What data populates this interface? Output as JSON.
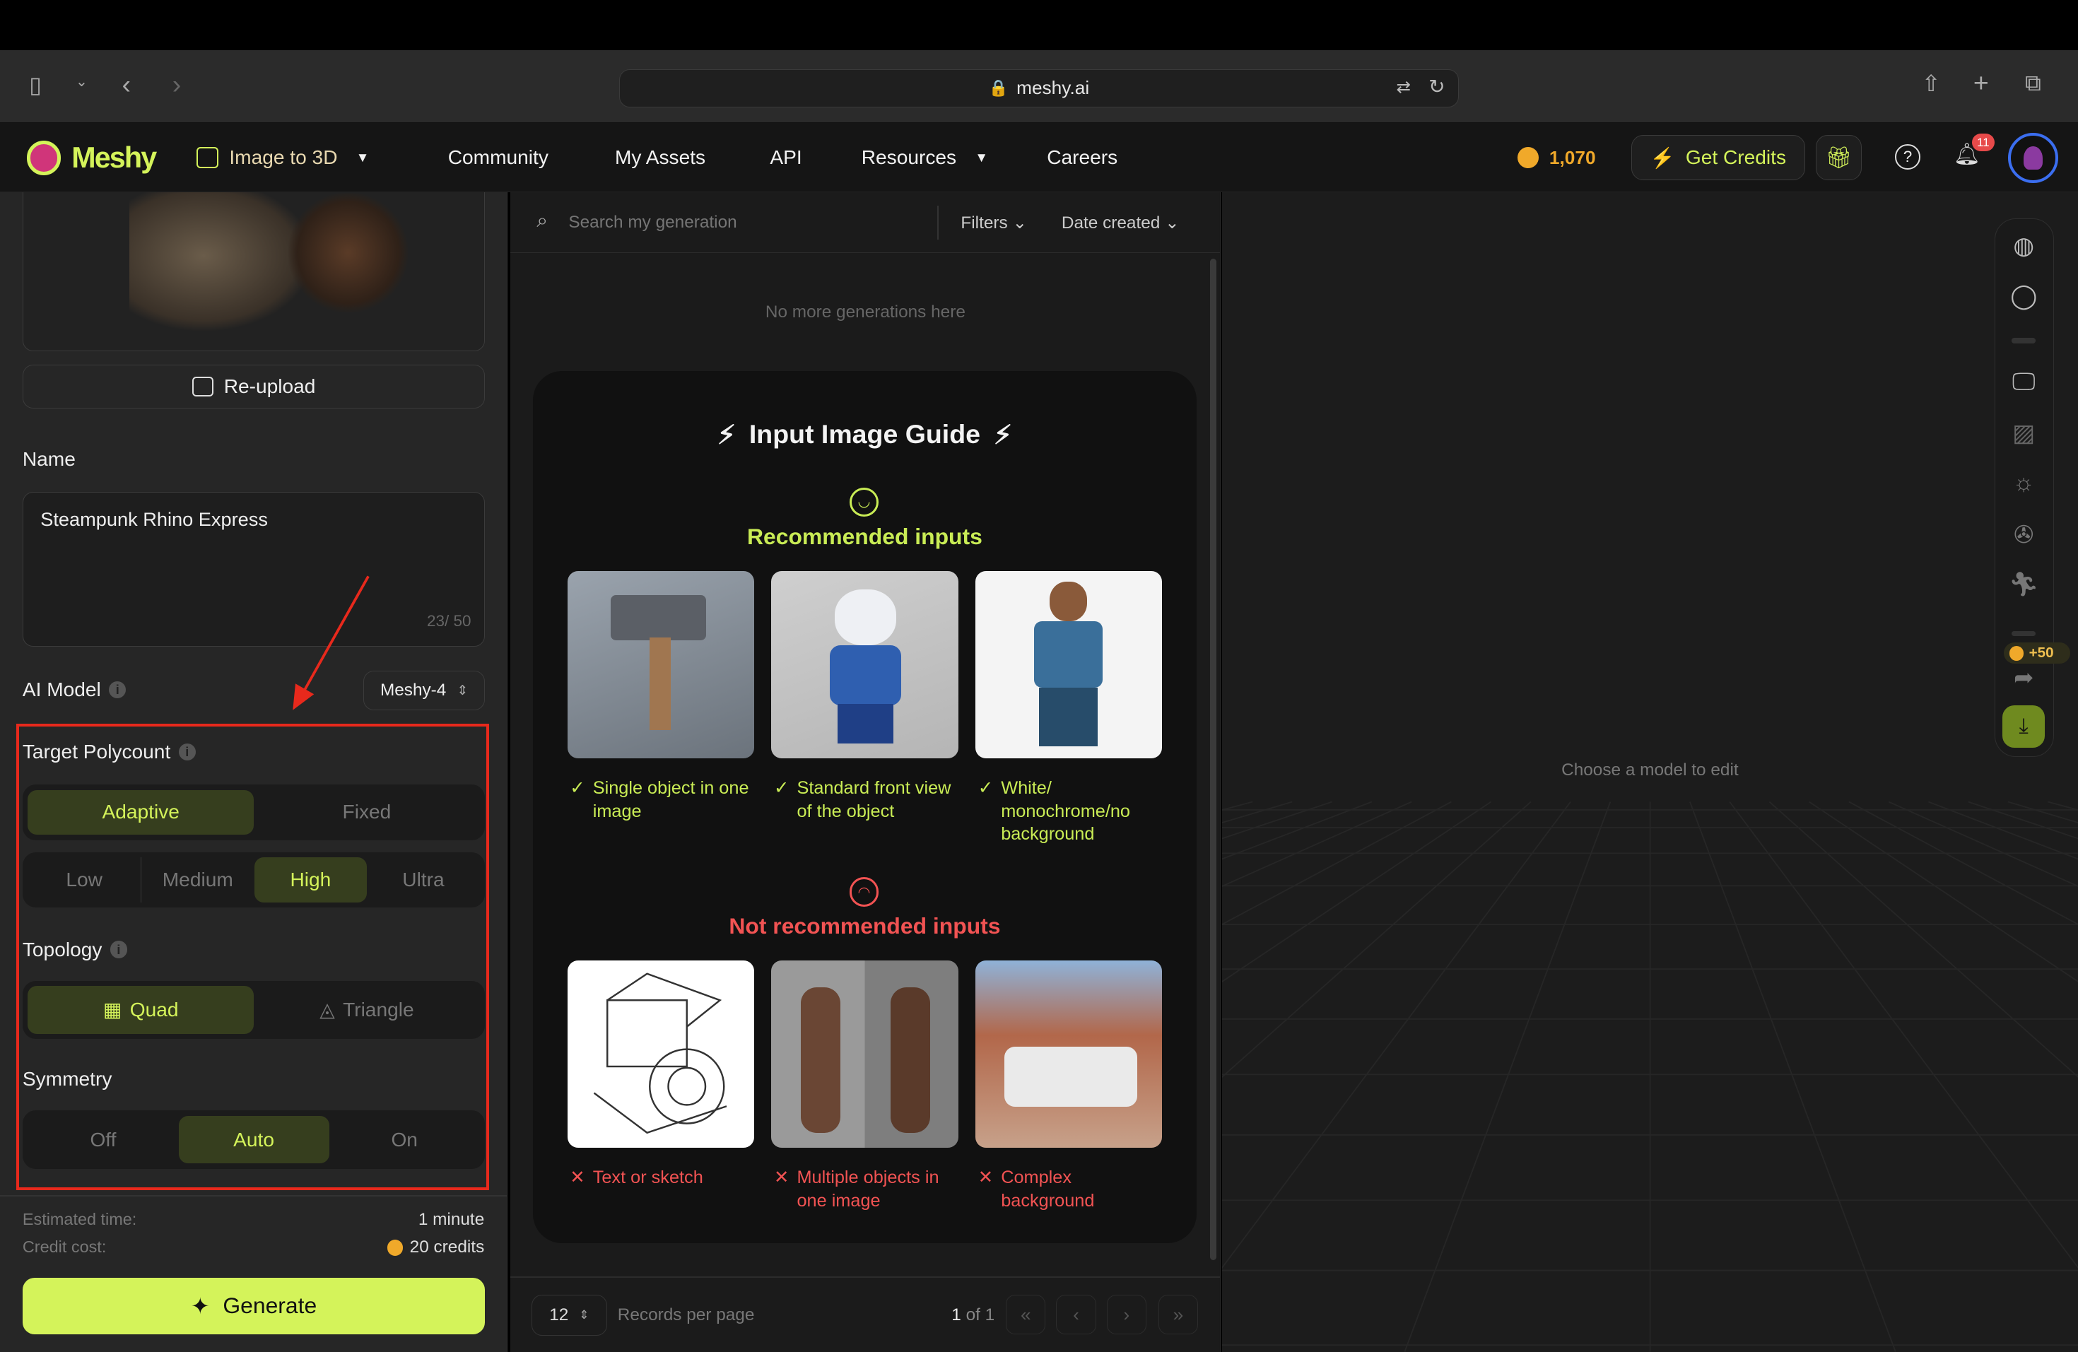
{
  "browser": {
    "url": "meshy.ai"
  },
  "nav": {
    "logo": "Meshy",
    "mode": "Image to 3D",
    "links": [
      "Community",
      "My Assets",
      "API",
      "Resources",
      "Careers"
    ],
    "credits": "1,070",
    "get_credits": "Get Credits",
    "notification_count": "11"
  },
  "left": {
    "reupload": "Re-upload",
    "name_label": "Name",
    "name_value": "Steampunk Rhino Express",
    "name_count": "23/ 50",
    "ai_model_label": "AI Model",
    "ai_model_value": "Meshy-4",
    "polycount_label": "Target Polycount",
    "polycount_modes": [
      "Adaptive",
      "Fixed"
    ],
    "polycount_selected": "Adaptive",
    "polycount_levels": [
      "Low",
      "Medium",
      "High",
      "Ultra"
    ],
    "polycount_level_selected": "High",
    "topology_label": "Topology",
    "topology_options": [
      "Quad",
      "Triangle"
    ],
    "topology_selected": "Quad",
    "symmetry_label": "Symmetry",
    "symmetry_options": [
      "Off",
      "Auto",
      "On"
    ],
    "symmetry_selected": "Auto",
    "est_time_label": "Estimated time:",
    "est_time_value": "1 minute",
    "credit_cost_label": "Credit cost:",
    "credit_cost_value": "20 credits",
    "generate": "Generate",
    "highlight_color": "#e8291c"
  },
  "mid": {
    "search_placeholder": "Search my generation",
    "filters": "Filters",
    "sort": "Date created",
    "empty": "No more generations here",
    "guide": {
      "title": "Input Image Guide",
      "recommended_title": "Recommended inputs",
      "recommended": [
        "Single object in one image",
        "Standard front view of the object",
        "White/ monochrome/no background"
      ],
      "not_recommended_title": "Not recommended inputs",
      "not_recommended": [
        "Text or sketch",
        "Multiple objects in one image",
        "Complex background"
      ]
    },
    "per_page": "12",
    "per_page_label": "Records per page",
    "page_current": "1",
    "page_of": "of 1"
  },
  "viewport": {
    "hint": "Choose a model to edit",
    "share_bonus": "+50"
  },
  "colors": {
    "accent": "#d4f35a",
    "danger": "#f25353",
    "coin": "#f0a92a"
  }
}
